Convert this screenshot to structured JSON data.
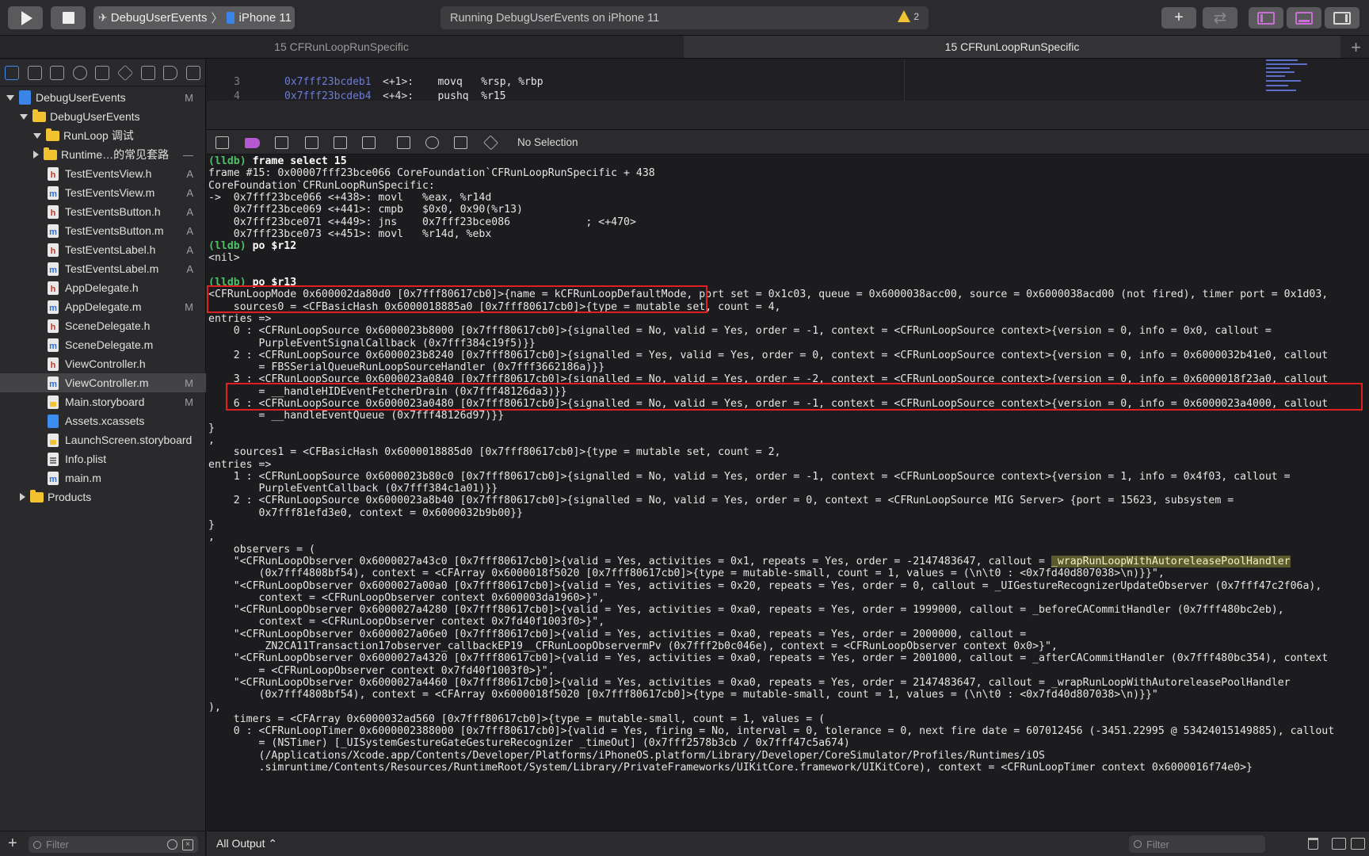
{
  "toolbar": {
    "scheme_app": "DebugUserEvents",
    "scheme_device": "iPhone 11",
    "status": "Running DebugUserEvents on iPhone 11",
    "warning_count": "2",
    "add_label": "+",
    "arrows_label": "⇄"
  },
  "tabs": [
    {
      "label": "15 CFRunLoopRunSpecific",
      "active": false
    },
    {
      "label": "15 CFRunLoopRunSpecific",
      "active": true
    }
  ],
  "tab_plus": "+",
  "navigator": {
    "items": [
      {
        "label": "DebugUserEvents",
        "kind": "project",
        "badge": "M"
      },
      {
        "label": "DebugUserEvents",
        "kind": "folder",
        "badge": ""
      },
      {
        "label": "RunLoop 调试",
        "kind": "folder",
        "badge": ""
      },
      {
        "label": "Runtime…的常见套路",
        "kind": "folder",
        "badge": "—"
      },
      {
        "label": "TestEventsView.h",
        "kind": "h",
        "badge": "A"
      },
      {
        "label": "TestEventsView.m",
        "kind": "m",
        "badge": "A"
      },
      {
        "label": "TestEventsButton.h",
        "kind": "h",
        "badge": "A"
      },
      {
        "label": "TestEventsButton.m",
        "kind": "m",
        "badge": "A"
      },
      {
        "label": "TestEventsLabel.h",
        "kind": "h",
        "badge": "A"
      },
      {
        "label": "TestEventsLabel.m",
        "kind": "m",
        "badge": "A"
      },
      {
        "label": "AppDelegate.h",
        "kind": "h",
        "badge": ""
      },
      {
        "label": "AppDelegate.m",
        "kind": "m",
        "badge": "M"
      },
      {
        "label": "SceneDelegate.h",
        "kind": "h",
        "badge": ""
      },
      {
        "label": "SceneDelegate.m",
        "kind": "m",
        "badge": ""
      },
      {
        "label": "ViewController.h",
        "kind": "h",
        "badge": ""
      },
      {
        "label": "ViewController.m",
        "kind": "m",
        "badge": "M"
      },
      {
        "label": "Main.storyboard",
        "kind": "sb",
        "badge": "M"
      },
      {
        "label": "Assets.xcassets",
        "kind": "xca",
        "badge": ""
      },
      {
        "label": "LaunchScreen.storyboard",
        "kind": "sb",
        "badge": ""
      },
      {
        "label": "Info.plist",
        "kind": "plist",
        "badge": ""
      },
      {
        "label": "main.m",
        "kind": "m",
        "badge": ""
      },
      {
        "label": "Products",
        "kind": "folder",
        "badge": ""
      }
    ],
    "filter_placeholder": "Filter",
    "add_label": "+"
  },
  "editor": {
    "lines": [
      {
        "num": "3",
        "addr": "0x7fff23bcdeb1",
        "off": "<+1>:",
        "text": "   movq   %rsp, %rbp"
      },
      {
        "num": "4",
        "addr": "0x7fff23bcdeb4",
        "off": "<+4>:",
        "text": "   pushq  %r15"
      }
    ]
  },
  "debugbar": {
    "no_selection": "No Selection"
  },
  "console": {
    "lines": [
      {
        "p": "(lldb) ",
        "c": "frame select 15"
      },
      {
        "t": "frame #15: 0x00007fff23bce066 CoreFoundation`CFRunLoopRunSpecific + 438"
      },
      {
        "t": "CoreFoundation`CFRunLoopRunSpecific:"
      },
      {
        "t": "->  0x7fff23bce066 <+438>: movl   %eax, %r14d"
      },
      {
        "t": "    0x7fff23bce069 <+441>: cmpb   $0x0, 0x90(%r13)"
      },
      {
        "t": "    0x7fff23bce071 <+449>: jns    0x7fff23bce086            ; <+470>"
      },
      {
        "t": "    0x7fff23bce073 <+451>: movl   %r14d, %ebx"
      },
      {
        "p": "(lldb) ",
        "c": "po $r12"
      },
      {
        "t": "<nil>"
      },
      {
        "t": ""
      },
      {
        "p": "(lldb) ",
        "c": "po $r13"
      },
      {
        "t": "<CFRunLoopMode 0x600002da80d0 [0x7fff80617cb0]>{name = kCFRunLoopDefaultMode, port set = 0x1c03, queue = 0x6000038acc00, source = 0x6000038acd00 (not fired), timer port = 0x1d03,"
      },
      {
        "t": "    sources0 = <CFBasicHash 0x6000018885a0 [0x7fff80617cb0]>{type = mutable set, count = 4,"
      },
      {
        "t": "entries =>"
      },
      {
        "t": "    0 : <CFRunLoopSource 0x6000023b8000 [0x7fff80617cb0]>{signalled = No, valid = Yes, order = -1, context = <CFRunLoopSource context>{version = 0, info = 0x0, callout ="
      },
      {
        "t": "        PurpleEventSignalCallback (0x7fff384c19f5)}}"
      },
      {
        "t": "    2 : <CFRunLoopSource 0x6000023b8240 [0x7fff80617cb0]>{signalled = Yes, valid = Yes, order = 0, context = <CFRunLoopSource context>{version = 0, info = 0x6000032b41e0, callout"
      },
      {
        "t": "        = FBSSerialQueueRunLoopSourceHandler (0x7fff3662186a)}}"
      },
      {
        "t": "    3 : <CFRunLoopSource 0x6000023a0840 [0x7fff80617cb0]>{signalled = No, valid = Yes, order = -2, context = <CFRunLoopSource context>{version = 0, info = 0x6000018f23a0, callout"
      },
      {
        "t": "        = __handleHIDEventFetcherDrain (0x7fff48126da3)}}"
      },
      {
        "t": "    6 : <CFRunLoopSource 0x6000023a0480 [0x7fff80617cb0]>{signalled = No, valid = Yes, order = -1, context = <CFRunLoopSource context>{version = 0, info = 0x6000023a4000, callout"
      },
      {
        "t": "        = __handleEventQueue (0x7fff48126d97)}}"
      },
      {
        "t": "}"
      },
      {
        "t": ","
      },
      {
        "t": "    sources1 = <CFBasicHash 0x6000018885d0 [0x7fff80617cb0]>{type = mutable set, count = 2,"
      },
      {
        "t": "entries =>"
      },
      {
        "t": "    1 : <CFRunLoopSource 0x6000023b80c0 [0x7fff80617cb0]>{signalled = No, valid = Yes, order = -1, context = <CFRunLoopSource context>{version = 1, info = 0x4f03, callout ="
      },
      {
        "t": "        PurpleEventCallback (0x7fff384c1a01)}}"
      },
      {
        "t": "    2 : <CFRunLoopSource 0x6000023a8b40 [0x7fff80617cb0]>{signalled = No, valid = Yes, order = 0, context = <CFRunLoopSource MIG Server> {port = 15623, subsystem ="
      },
      {
        "t": "        0x7fff81efd3e0, context = 0x6000032b9b00}}"
      },
      {
        "t": "}"
      },
      {
        "t": ","
      },
      {
        "t": "    observers = ("
      },
      {
        "t": "    \"<CFRunLoopObserver 0x6000027a43c0 [0x7fff80617cb0]>{valid = Yes, activities = 0x1, repeats = Yes, order = -2147483647, callout = ",
        "h": "_wrapRunLoopWithAutoreleasePoolHandler"
      },
      {
        "t": "        (0x7fff4808bf54), context = <CFArray 0x6000018f5020 [0x7fff80617cb0]>{type = mutable-small, count = 1, values = (\\n\\t0 : <0x7fd40d807038>\\n)}}\","
      },
      {
        "t": "    \"<CFRunLoopObserver 0x6000027a00a0 [0x7fff80617cb0]>{valid = Yes, activities = 0x20, repeats = Yes, order = 0, callout = _UIGestureRecognizerUpdateObserver (0x7fff47c2f06a),"
      },
      {
        "t": "        context = <CFRunLoopObserver context 0x600003da1960>}\","
      },
      {
        "t": "    \"<CFRunLoopObserver 0x6000027a4280 [0x7fff80617cb0]>{valid = Yes, activities = 0xa0, repeats = Yes, order = 1999000, callout = _beforeCACommitHandler (0x7fff480bc2eb),"
      },
      {
        "t": "        context = <CFRunLoopObserver context 0x7fd40f1003f0>}\","
      },
      {
        "t": "    \"<CFRunLoopObserver 0x6000027a06e0 [0x7fff80617cb0]>{valid = Yes, activities = 0xa0, repeats = Yes, order = 2000000, callout ="
      },
      {
        "t": "        _ZN2CA11Transaction17observer_callbackEP19__CFRunLoopObservermPv (0x7fff2b0c046e), context = <CFRunLoopObserver context 0x0>}\","
      },
      {
        "t": "    \"<CFRunLoopObserver 0x6000027a4320 [0x7fff80617cb0]>{valid = Yes, activities = 0xa0, repeats = Yes, order = 2001000, callout = _afterCACommitHandler (0x7fff480bc354), context"
      },
      {
        "t": "        = <CFRunLoopObserver context 0x7fd40f1003f0>}\","
      },
      {
        "t": "    \"<CFRunLoopObserver 0x6000027a4460 [0x7fff80617cb0]>{valid = Yes, activities = 0xa0, repeats = Yes, order = 2147483647, callout = _wrapRunLoopWithAutoreleasePoolHandler"
      },
      {
        "t": "        (0x7fff4808bf54), context = <CFArray 0x6000018f5020 [0x7fff80617cb0]>{type = mutable-small, count = 1, values = (\\n\\t0 : <0x7fd40d807038>\\n)}}\""
      },
      {
        "t": "),"
      },
      {
        "t": "    timers = <CFArray 0x6000032ad560 [0x7fff80617cb0]>{type = mutable-small, count = 1, values = ("
      },
      {
        "t": "    0 : <CFRunLoopTimer 0x6000002388000 [0x7fff80617cb0]>{valid = Yes, firing = No, interval = 0, tolerance = 0, next fire date = 607012456 (-3451.22995 @ 53424015149885), callout"
      },
      {
        "t": "        = (NSTimer) [_UISystemGestureGateGestureRecognizer _timeOut] (0x7fff2578b3cb / 0x7fff47c5a674)"
      },
      {
        "t": "        (/Applications/Xcode.app/Contents/Developer/Platforms/iPhoneOS.platform/Library/Developer/CoreSimulator/Profiles/Runtimes/iOS"
      },
      {
        "t": "        .simruntime/Contents/Resources/RuntimeRoot/System/Library/PrivateFrameworks/UIKitCore.framework/UIKitCore), context = <CFRunLoopTimer context 0x6000016f74e0>}"
      }
    ]
  },
  "console_bottom": {
    "output_select": "All Output ⌃",
    "filter_placeholder": "Filter"
  }
}
